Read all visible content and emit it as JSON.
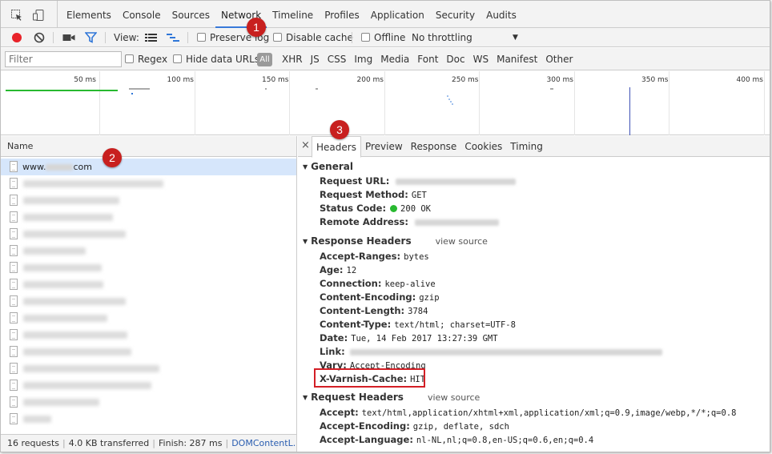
{
  "tabs": [
    "Elements",
    "Console",
    "Sources",
    "Network",
    "Timeline",
    "Profiles",
    "Application",
    "Security",
    "Audits"
  ],
  "active_tab": "Network",
  "toolbar": {
    "view_label": "View:",
    "preserve_log": "Preserve log",
    "disable_cache": "Disable cache",
    "offline": "Offline",
    "throttling": "No throttling"
  },
  "filter": {
    "placeholder": "Filter",
    "regex": "Regex",
    "hide_data_urls": "Hide data URLs",
    "all": "All",
    "types": [
      "XHR",
      "JS",
      "CSS",
      "Img",
      "Media",
      "Font",
      "Doc",
      "WS",
      "Manifest",
      "Other"
    ]
  },
  "overview_ticks": [
    "50 ms",
    "100 ms",
    "150 ms",
    "200 ms",
    "250 ms",
    "300 ms",
    "350 ms",
    "400 ms"
  ],
  "list": {
    "header": "Name",
    "first_item": "www.",
    "first_item_suffix": "com"
  },
  "status_bar": {
    "requests": "16 requests",
    "transferred": "4.0 KB transferred",
    "finish": "Finish: 287 ms",
    "dcl": "DOMContentL..."
  },
  "details": {
    "close": "×",
    "tabs": [
      "Headers",
      "Preview",
      "Response",
      "Cookies",
      "Timing"
    ],
    "general": {
      "title": "General",
      "request_url_key": "Request URL:",
      "request_method_key": "Request Method:",
      "request_method": "GET",
      "status_code_key": "Status Code:",
      "status_code": "200 OK",
      "remote_address_key": "Remote Address:"
    },
    "response_headers": {
      "title": "Response Headers",
      "view_source": "view source",
      "items": [
        {
          "k": "Accept-Ranges:",
          "v": "bytes"
        },
        {
          "k": "Age:",
          "v": "12"
        },
        {
          "k": "Connection:",
          "v": "keep-alive"
        },
        {
          "k": "Content-Encoding:",
          "v": "gzip"
        },
        {
          "k": "Content-Length:",
          "v": "3784"
        },
        {
          "k": "Content-Type:",
          "v": "text/html; charset=UTF-8"
        },
        {
          "k": "Date:",
          "v": "Tue, 14 Feb 2017 13:27:39 GMT"
        },
        {
          "k": "Link:",
          "v": ""
        },
        {
          "k": "Vary:",
          "v": "Accept-Encoding"
        },
        {
          "k": "X-Varnish-Cache:",
          "v": "HIT"
        }
      ]
    },
    "request_headers": {
      "title": "Request Headers",
      "view_source": "view source",
      "items": [
        {
          "k": "Accept:",
          "v": "text/html,application/xhtml+xml,application/xml;q=0.9,image/webp,*/*;q=0.8"
        },
        {
          "k": "Accept-Encoding:",
          "v": "gzip, deflate, sdch"
        },
        {
          "k": "Accept-Language:",
          "v": "nl-NL,nl;q=0.8,en-US;q=0.6,en;q=0.4"
        }
      ]
    }
  },
  "callouts": [
    "1",
    "2",
    "3"
  ],
  "colors": {
    "accent": "#3879d9",
    "callout": "#c8201f",
    "status_ok": "#28b930",
    "selected_row": "#d6e6fb",
    "record": "#e8232a"
  }
}
